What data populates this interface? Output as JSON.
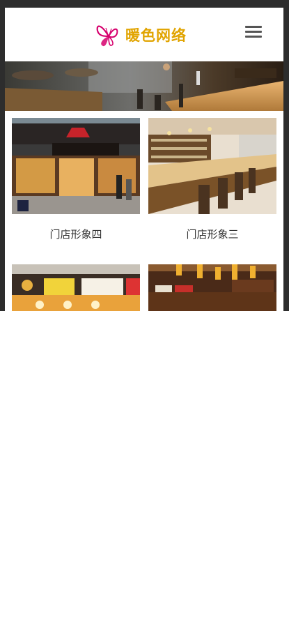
{
  "header": {
    "logo_text": "暖色网络",
    "menu_icon": "hamburger-menu-icon"
  },
  "gallery": {
    "items": [
      {
        "title": "门店形象四",
        "image": "pizza-hut-storefront"
      },
      {
        "title": "门店形象三",
        "image": "bar-counter-interior"
      },
      {
        "title": "",
        "image": "japanese-restaurant-front"
      },
      {
        "title": "",
        "image": "lantern-restaurant-interior"
      }
    ]
  },
  "colors": {
    "frame": "#2d2d2d",
    "logo_accent": "#e1a400",
    "butterfly": "#d6006d"
  }
}
